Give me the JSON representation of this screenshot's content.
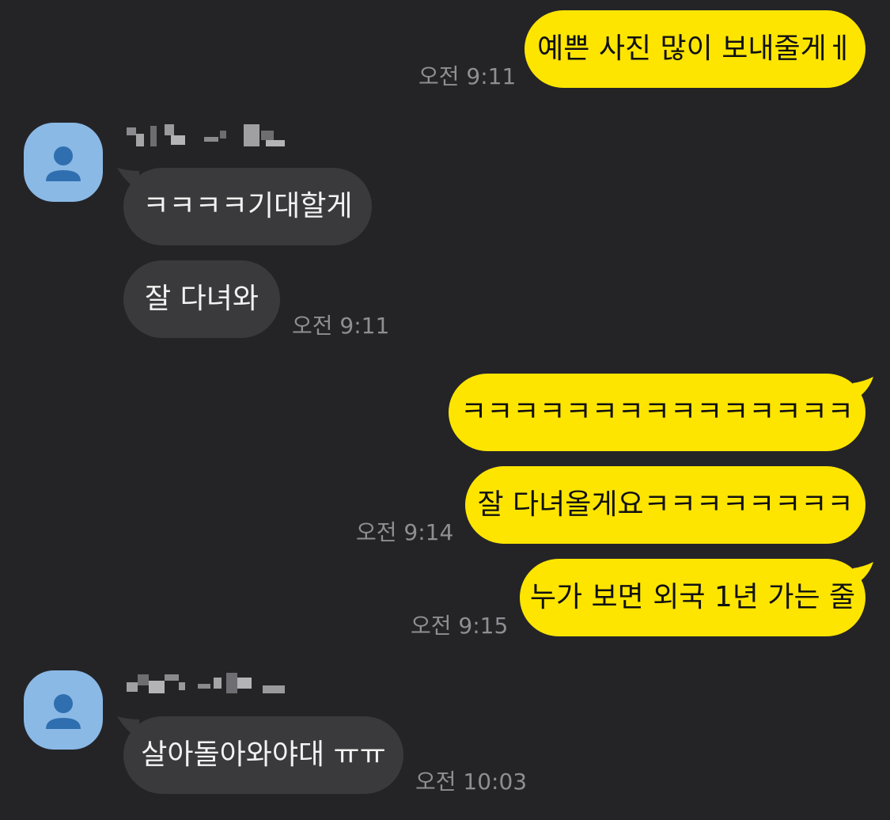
{
  "colors": {
    "background": "#242427",
    "my_bubble": "#FEE500",
    "their_bubble": "#3A3A3C",
    "timestamp": "#8E8E93",
    "avatar": "#8AB9E6"
  },
  "messages": [
    {
      "from": "me",
      "text": "예쁜 사진 많이 보내줄게ㅔ",
      "time": "오전 9:11"
    },
    {
      "from": "them",
      "text": "ㅋㅋㅋㅋ기대할게"
    },
    {
      "from": "them",
      "text": "잘 다녀와",
      "time": "오전 9:11"
    },
    {
      "from": "me",
      "text": "ㅋㅋㅋㅋㅋㅋㅋㅋㅋㅋㅋㅋㅋㅋㅋ"
    },
    {
      "from": "me",
      "text": "잘 다녀올게요ㅋㅋㅋㅋㅋㅋㅋㅋ",
      "time": "오전 9:14"
    },
    {
      "from": "me",
      "text": "누가 보면 외국 1년 가는 줄",
      "time": "오전 9:15"
    },
    {
      "from": "them",
      "text": "살아돌아와야대 ㅠㅠ",
      "time": "오전 10:03"
    }
  ],
  "avatar_icon": "person-icon"
}
